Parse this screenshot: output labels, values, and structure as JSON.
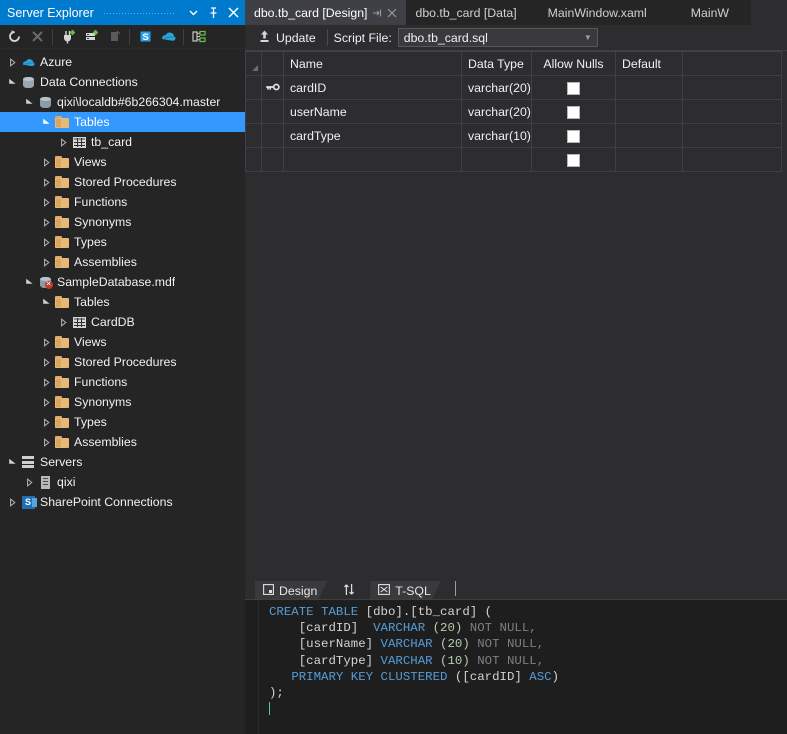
{
  "explorer": {
    "title": "Server Explorer",
    "header_icons": [
      {
        "name": "chevron-down-icon",
        "glyph": "▾"
      },
      {
        "name": "pin-icon",
        "glyph": "⍑"
      },
      {
        "name": "close-icon",
        "glyph": "✕"
      }
    ],
    "toolbar": [
      {
        "name": "refresh-button",
        "title": "Refresh"
      },
      {
        "name": "stop-button",
        "title": "Stop"
      },
      {
        "name": "connect-to-database-button",
        "title": "Connect to Database"
      },
      {
        "name": "add-server-button",
        "title": "Add Server"
      },
      {
        "name": "disconnect-button",
        "title": "Disconnect"
      },
      {
        "name": "sharepoint-connection-button",
        "title": "Add SharePoint Connection"
      },
      {
        "name": "azure-connection-button",
        "title": "Azure"
      },
      {
        "name": "object-hierarchy-button",
        "title": "Object Hierarchy"
      }
    ],
    "tree": [
      {
        "label": "Azure",
        "indent": 0,
        "icon": "azure-icon",
        "twisty": "collapsed",
        "selected": false
      },
      {
        "label": "Data Connections",
        "indent": 0,
        "icon": "data-connections-icon",
        "twisty": "expanded",
        "selected": false
      },
      {
        "label": "qixi\\localdb#6b266304.master",
        "indent": 1,
        "icon": "database-icon",
        "twisty": "expanded",
        "selected": false
      },
      {
        "label": "Tables",
        "indent": 2,
        "icon": "folder-icon",
        "twisty": "expanded",
        "selected": true
      },
      {
        "label": "tb_card",
        "indent": 3,
        "icon": "table-icon",
        "twisty": "collapsed",
        "selected": false
      },
      {
        "label": "Views",
        "indent": 2,
        "icon": "folder-icon",
        "twisty": "collapsed",
        "selected": false
      },
      {
        "label": "Stored Procedures",
        "indent": 2,
        "icon": "folder-icon",
        "twisty": "collapsed",
        "selected": false
      },
      {
        "label": "Functions",
        "indent": 2,
        "icon": "folder-icon",
        "twisty": "collapsed",
        "selected": false
      },
      {
        "label": "Synonyms",
        "indent": 2,
        "icon": "folder-icon",
        "twisty": "collapsed",
        "selected": false
      },
      {
        "label": "Types",
        "indent": 2,
        "icon": "folder-icon",
        "twisty": "collapsed",
        "selected": false
      },
      {
        "label": "Assemblies",
        "indent": 2,
        "icon": "folder-icon",
        "twisty": "collapsed",
        "selected": false
      },
      {
        "label": "SampleDatabase.mdf",
        "indent": 1,
        "icon": "database-error-icon",
        "twisty": "expanded",
        "selected": false
      },
      {
        "label": "Tables",
        "indent": 2,
        "icon": "folder-icon",
        "twisty": "expanded",
        "selected": false
      },
      {
        "label": "CardDB",
        "indent": 3,
        "icon": "table-icon",
        "twisty": "collapsed",
        "selected": false
      },
      {
        "label": "Views",
        "indent": 2,
        "icon": "folder-icon",
        "twisty": "collapsed",
        "selected": false
      },
      {
        "label": "Stored Procedures",
        "indent": 2,
        "icon": "folder-icon",
        "twisty": "collapsed",
        "selected": false
      },
      {
        "label": "Functions",
        "indent": 2,
        "icon": "folder-icon",
        "twisty": "collapsed",
        "selected": false
      },
      {
        "label": "Synonyms",
        "indent": 2,
        "icon": "folder-icon",
        "twisty": "collapsed",
        "selected": false
      },
      {
        "label": "Types",
        "indent": 2,
        "icon": "folder-icon",
        "twisty": "collapsed",
        "selected": false
      },
      {
        "label": "Assemblies",
        "indent": 2,
        "icon": "folder-icon",
        "twisty": "collapsed",
        "selected": false
      },
      {
        "label": "Servers",
        "indent": 0,
        "icon": "servers-icon",
        "twisty": "expanded",
        "selected": false
      },
      {
        "label": "qixi",
        "indent": 1,
        "icon": "server-icon",
        "twisty": "collapsed",
        "selected": false
      },
      {
        "label": "SharePoint Connections",
        "indent": 0,
        "icon": "sharepoint-icon",
        "twisty": "collapsed",
        "selected": false
      }
    ]
  },
  "tabs": [
    {
      "label": "dbo.tb_card [Design]",
      "active": true,
      "pin": "⇥",
      "close": "✕"
    },
    {
      "label": "dbo.tb_card [Data]",
      "active": false
    },
    {
      "label": "MainWindow.xaml",
      "active": false
    },
    {
      "label": "MainW",
      "active": false
    }
  ],
  "designer_toolbar": {
    "update_label": "Update",
    "update_icon": "upload-arrow-icon",
    "script_file_label": "Script File:",
    "script_file_value": "dbo.tb_card.sql",
    "dropdown_caret": "▾"
  },
  "grid": {
    "headers": [
      "Name",
      "Data Type",
      "Allow Nulls",
      "Default"
    ],
    "rows": [
      {
        "key": true,
        "name": "cardID",
        "type": "varchar(20)",
        "allow_nulls": false,
        "default": ""
      },
      {
        "key": false,
        "name": "userName",
        "type": "varchar(20)",
        "allow_nulls": false,
        "default": ""
      },
      {
        "key": false,
        "name": "cardType",
        "type": "varchar(10)",
        "allow_nulls": false,
        "default": ""
      },
      {
        "key": false,
        "name": "",
        "type": "",
        "allow_nulls": false,
        "default": ""
      }
    ]
  },
  "split_tabs": [
    {
      "label": "Design",
      "icon": "design-pane-icon",
      "active": true
    },
    {
      "label": "",
      "icon": "swap-arrows-icon",
      "active": false
    },
    {
      "label": "T-SQL",
      "icon": "tsql-pane-icon",
      "active": true
    }
  ],
  "code": {
    "lines": [
      [
        {
          "t": "CREATE TABLE ",
          "c": "k"
        },
        {
          "t": "[dbo].[tb_card] (",
          "c": "p"
        }
      ],
      [
        {
          "t": "    ",
          "c": "dotguide"
        },
        {
          "t": "[cardID]  ",
          "c": "id"
        },
        {
          "t": "VARCHAR ",
          "c": "k"
        },
        {
          "t": "(20)",
          "c": "n"
        },
        {
          "t": " NOT NULL,",
          "c": "g"
        }
      ],
      [
        {
          "t": "    ",
          "c": "dotguide"
        },
        {
          "t": "[userName] ",
          "c": "id"
        },
        {
          "t": "VARCHAR ",
          "c": "k"
        },
        {
          "t": "(20)",
          "c": "n"
        },
        {
          "t": " NOT NULL,",
          "c": "g"
        }
      ],
      [
        {
          "t": "    ",
          "c": "dotguide"
        },
        {
          "t": "[cardType] ",
          "c": "id"
        },
        {
          "t": "VARCHAR ",
          "c": "k"
        },
        {
          "t": "(10)",
          "c": "n"
        },
        {
          "t": " NOT NULL,",
          "c": "g"
        }
      ],
      [
        {
          "t": "   ",
          "c": "dotguide"
        },
        {
          "t": "PRIMARY KEY CLUSTERED ",
          "c": "k"
        },
        {
          "t": "([cardID] ",
          "c": "id"
        },
        {
          "t": "ASC",
          "c": "k"
        },
        {
          "t": ")",
          "c": "id"
        }
      ],
      [
        {
          "t": ");",
          "c": "p"
        }
      ]
    ]
  }
}
